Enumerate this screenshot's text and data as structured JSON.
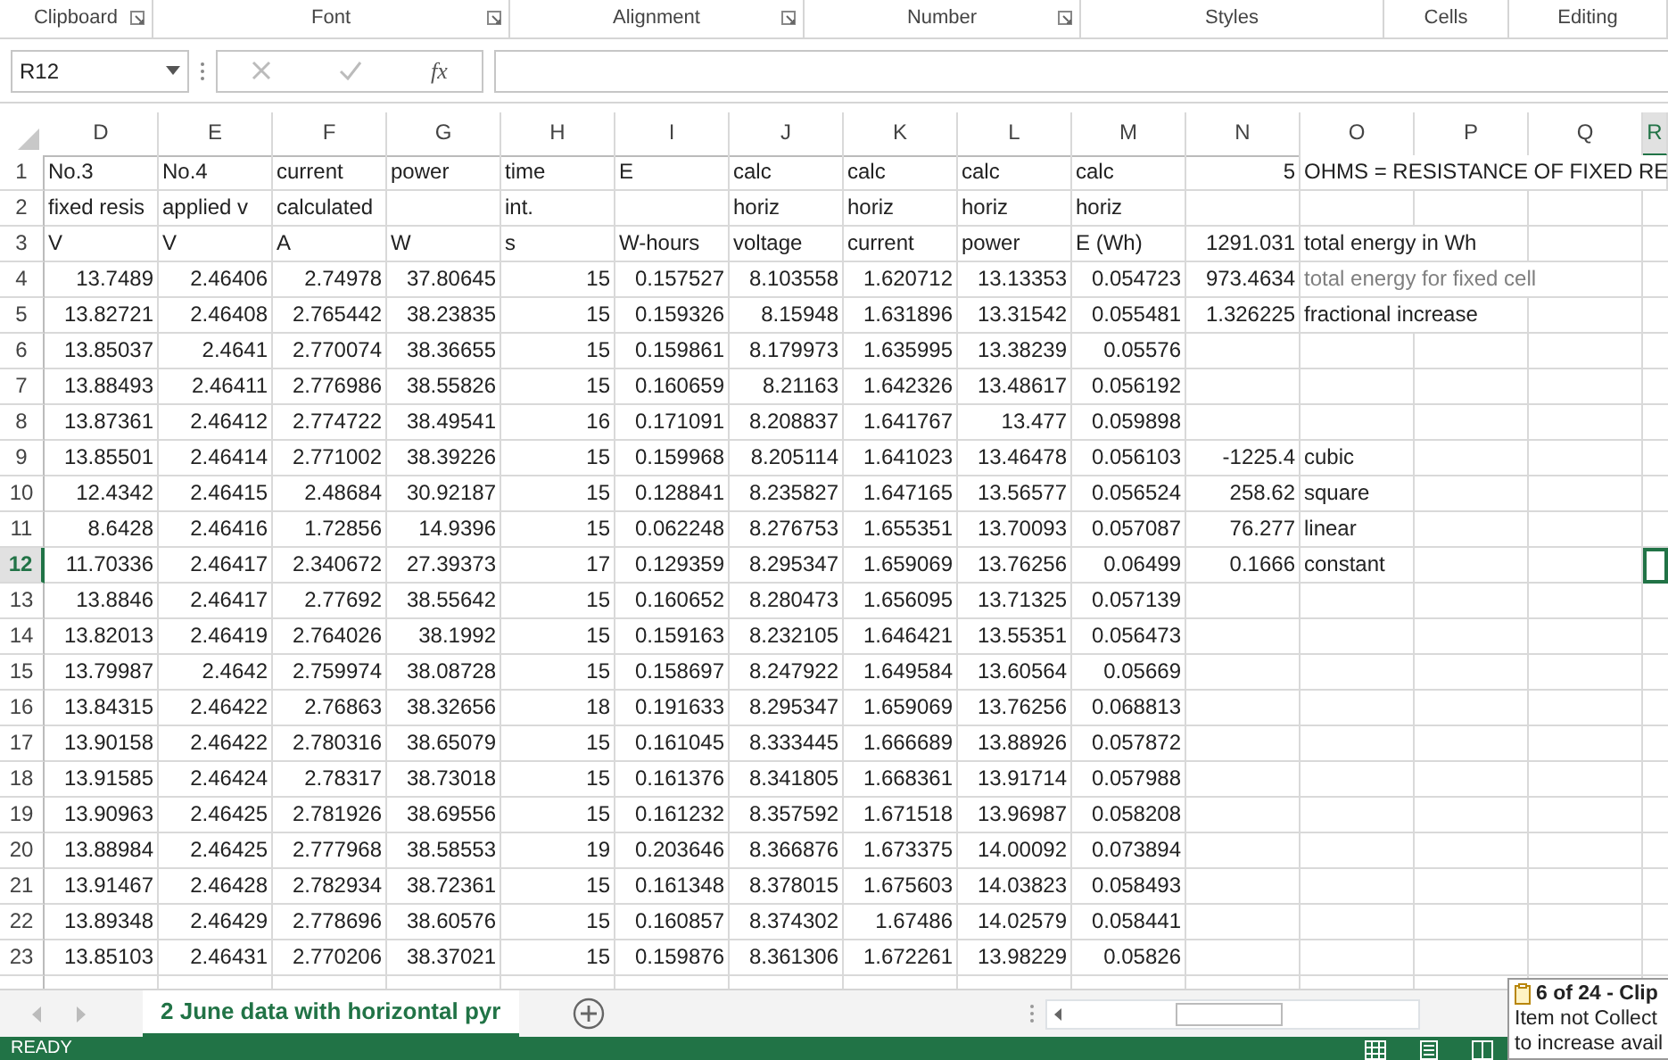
{
  "ribbon_groups": [
    {
      "label": "Clipboard",
      "launcher": true
    },
    {
      "label": "Font",
      "launcher": true
    },
    {
      "label": "Alignment",
      "launcher": true
    },
    {
      "label": "Number",
      "launcher": true
    },
    {
      "label": "Styles",
      "launcher": false
    },
    {
      "label": "Cells",
      "launcher": false
    },
    {
      "label": "Editing",
      "launcher": false
    }
  ],
  "formula_bar": {
    "name_box": "R12",
    "function_label": "fx"
  },
  "columns": [
    {
      "label": "D",
      "selected": false
    },
    {
      "label": "E",
      "selected": false
    },
    {
      "label": "F",
      "selected": false
    },
    {
      "label": "G",
      "selected": false
    },
    {
      "label": "H",
      "selected": false
    },
    {
      "label": "I",
      "selected": false
    },
    {
      "label": "J",
      "selected": false
    },
    {
      "label": "K",
      "selected": false
    },
    {
      "label": "L",
      "selected": false
    },
    {
      "label": "M",
      "selected": false
    },
    {
      "label": "N",
      "selected": false
    },
    {
      "label": "O",
      "selected": false
    },
    {
      "label": "P",
      "selected": false
    },
    {
      "label": "Q",
      "selected": false
    },
    {
      "label": "R",
      "selected": true
    }
  ],
  "rows": [
    {
      "number": "1",
      "selected": false,
      "cells": {
        "N": "5"
      },
      "labels": {
        "D": "No.3",
        "E": "No.4",
        "F": "current",
        "G": "power",
        "H": "time",
        "I": "E",
        "J": "calc",
        "K": "calc",
        "L": "calc",
        "M": "calc",
        "O": "OHMS = RESISTANCE OF FIXED RE"
      }
    },
    {
      "number": "2",
      "selected": false,
      "cells": {},
      "labels": {
        "D": "fixed resis",
        "E": "applied v",
        "F": "calculated",
        "H": "int.",
        "J": "horiz",
        "K": "horiz",
        "L": "horiz",
        "M": "horiz"
      }
    },
    {
      "number": "3",
      "selected": false,
      "cells": {
        "N": "1291.031"
      },
      "labels": {
        "D": "V",
        "E": "V",
        "F": "A",
        "G": "W",
        "H": "s",
        "I": "W-hours",
        "J": "voltage",
        "K": "current",
        "L": "power",
        "M": "E (Wh)",
        "O": "total energy in Wh"
      }
    },
    {
      "number": "4",
      "selected": false,
      "cells": {
        "D": "13.7489",
        "E": "2.46406",
        "F": "2.74978",
        "G": "37.80645",
        "H": "15",
        "I": "0.157527",
        "J": "8.103558",
        "K": "1.620712",
        "L": "13.13353",
        "M": "0.054723",
        "N": "973.4634"
      },
      "labels": {
        "O": {
          "text": "total energy for fixed cell",
          "dimmed": true
        }
      }
    },
    {
      "number": "5",
      "selected": false,
      "cells": {
        "D": "13.82721",
        "E": "2.46408",
        "F": "2.765442",
        "G": "38.23835",
        "H": "15",
        "I": "0.159326",
        "J": "8.15948",
        "K": "1.631896",
        "L": "13.31542",
        "M": "0.055481",
        "N": "1.326225"
      },
      "labels": {
        "O": "fractional increase"
      }
    },
    {
      "number": "6",
      "selected": false,
      "cells": {
        "D": "13.85037",
        "E": "2.4641",
        "F": "2.770074",
        "G": "38.36655",
        "H": "15",
        "I": "0.159861",
        "J": "8.179973",
        "K": "1.635995",
        "L": "13.38239",
        "M": "0.05576"
      },
      "labels": {}
    },
    {
      "number": "7",
      "selected": false,
      "cells": {
        "D": "13.88493",
        "E": "2.46411",
        "F": "2.776986",
        "G": "38.55826",
        "H": "15",
        "I": "0.160659",
        "J": "8.21163",
        "K": "1.642326",
        "L": "13.48617",
        "M": "0.056192"
      },
      "labels": {}
    },
    {
      "number": "8",
      "selected": false,
      "cells": {
        "D": "13.87361",
        "E": "2.46412",
        "F": "2.774722",
        "G": "38.49541",
        "H": "16",
        "I": "0.171091",
        "J": "8.208837",
        "K": "1.641767",
        "L": "13.477",
        "M": "0.059898"
      },
      "labels": {}
    },
    {
      "number": "9",
      "selected": false,
      "cells": {
        "D": "13.85501",
        "E": "2.46414",
        "F": "2.771002",
        "G": "38.39226",
        "H": "15",
        "I": "0.159968",
        "J": "8.205114",
        "K": "1.641023",
        "L": "13.46478",
        "M": "0.056103",
        "N": "-1225.4"
      },
      "labels": {
        "O": "cubic"
      }
    },
    {
      "number": "10",
      "selected": false,
      "cells": {
        "D": "12.4342",
        "E": "2.46415",
        "F": "2.48684",
        "G": "30.92187",
        "H": "15",
        "I": "0.128841",
        "J": "8.235827",
        "K": "1.647165",
        "L": "13.56577",
        "M": "0.056524",
        "N": "258.62"
      },
      "labels": {
        "O": "square"
      }
    },
    {
      "number": "11",
      "selected": false,
      "cells": {
        "D": "8.6428",
        "E": "2.46416",
        "F": "1.72856",
        "G": "14.9396",
        "H": "15",
        "I": "0.062248",
        "J": "8.276753",
        "K": "1.655351",
        "L": "13.70093",
        "M": "0.057087",
        "N": "76.277"
      },
      "labels": {
        "O": "linear"
      }
    },
    {
      "number": "12",
      "selected": true,
      "cells": {
        "D": "11.70336",
        "E": "2.46417",
        "F": "2.340672",
        "G": "27.39373",
        "H": "17",
        "I": "0.129359",
        "J": "8.295347",
        "K": "1.659069",
        "L": "13.76256",
        "M": "0.06499",
        "N": "0.1666"
      },
      "labels": {
        "O": "constant"
      }
    },
    {
      "number": "13",
      "selected": false,
      "cells": {
        "D": "13.8846",
        "E": "2.46417",
        "F": "2.77692",
        "G": "38.55642",
        "H": "15",
        "I": "0.160652",
        "J": "8.280473",
        "K": "1.656095",
        "L": "13.71325",
        "M": "0.057139"
      },
      "labels": {}
    },
    {
      "number": "14",
      "selected": false,
      "cells": {
        "D": "13.82013",
        "E": "2.46419",
        "F": "2.764026",
        "G": "38.1992",
        "H": "15",
        "I": "0.159163",
        "J": "8.232105",
        "K": "1.646421",
        "L": "13.55351",
        "M": "0.056473"
      },
      "labels": {}
    },
    {
      "number": "15",
      "selected": false,
      "cells": {
        "D": "13.79987",
        "E": "2.4642",
        "F": "2.759974",
        "G": "38.08728",
        "H": "15",
        "I": "0.158697",
        "J": "8.247922",
        "K": "1.649584",
        "L": "13.60564",
        "M": "0.05669"
      },
      "labels": {}
    },
    {
      "number": "16",
      "selected": false,
      "cells": {
        "D": "13.84315",
        "E": "2.46422",
        "F": "2.76863",
        "G": "38.32656",
        "H": "18",
        "I": "0.191633",
        "J": "8.295347",
        "K": "1.659069",
        "L": "13.76256",
        "M": "0.068813"
      },
      "labels": {}
    },
    {
      "number": "17",
      "selected": false,
      "cells": {
        "D": "13.90158",
        "E": "2.46422",
        "F": "2.780316",
        "G": "38.65079",
        "H": "15",
        "I": "0.161045",
        "J": "8.333445",
        "K": "1.666689",
        "L": "13.88926",
        "M": "0.057872"
      },
      "labels": {}
    },
    {
      "number": "18",
      "selected": false,
      "cells": {
        "D": "13.91585",
        "E": "2.46424",
        "F": "2.78317",
        "G": "38.73018",
        "H": "15",
        "I": "0.161376",
        "J": "8.341805",
        "K": "1.668361",
        "L": "13.91714",
        "M": "0.057988"
      },
      "labels": {}
    },
    {
      "number": "19",
      "selected": false,
      "cells": {
        "D": "13.90963",
        "E": "2.46425",
        "F": "2.781926",
        "G": "38.69556",
        "H": "15",
        "I": "0.161232",
        "J": "8.357592",
        "K": "1.671518",
        "L": "13.96987",
        "M": "0.058208"
      },
      "labels": {}
    },
    {
      "number": "20",
      "selected": false,
      "cells": {
        "D": "13.88984",
        "E": "2.46425",
        "F": "2.777968",
        "G": "38.58553",
        "H": "19",
        "I": "0.203646",
        "J": "8.366876",
        "K": "1.673375",
        "L": "14.00092",
        "M": "0.073894"
      },
      "labels": {}
    },
    {
      "number": "21",
      "selected": false,
      "cells": {
        "D": "13.91467",
        "E": "2.46428",
        "F": "2.782934",
        "G": "38.72361",
        "H": "15",
        "I": "0.161348",
        "J": "8.378015",
        "K": "1.675603",
        "L": "14.03823",
        "M": "0.058493"
      },
      "labels": {}
    },
    {
      "number": "22",
      "selected": false,
      "cells": {
        "D": "13.89348",
        "E": "2.46429",
        "F": "2.778696",
        "G": "38.60576",
        "H": "15",
        "I": "0.160857",
        "J": "8.374302",
        "K": "1.67486",
        "L": "14.02579",
        "M": "0.058441"
      },
      "labels": {}
    },
    {
      "number": "23",
      "selected": false,
      "cells": {
        "D": "13.85103",
        "E": "2.46431",
        "F": "2.770206",
        "G": "38.37021",
        "H": "15",
        "I": "0.159876",
        "J": "8.361306",
        "K": "1.672261",
        "L": "13.98229",
        "M": "0.05826"
      },
      "labels": {}
    }
  ],
  "sheet_tabs": [
    {
      "label": "2 June data with horizontal pyr",
      "selected": true
    }
  ],
  "status": "READY",
  "clipboard_popup": {
    "title": "6 of 24 - Clip",
    "lines": [
      "Item not Collect",
      "to increase avail"
    ]
  }
}
